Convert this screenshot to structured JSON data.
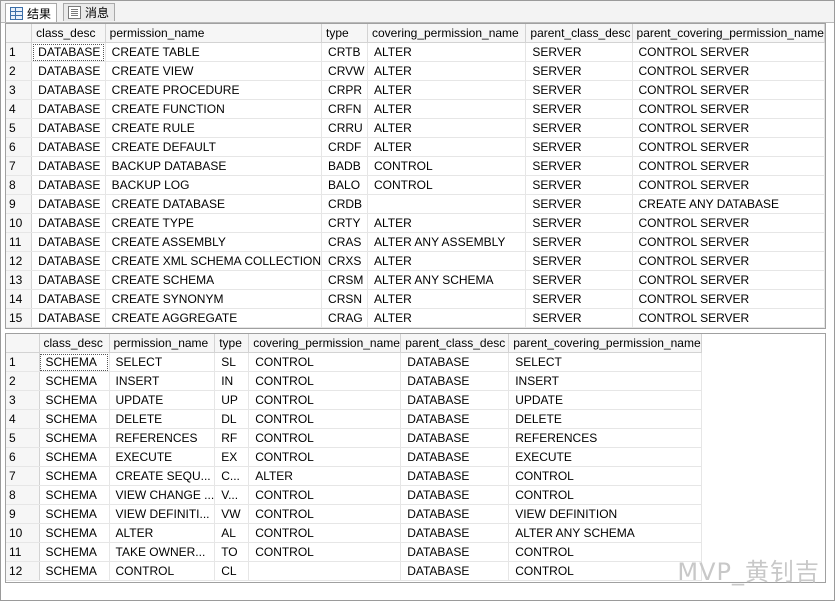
{
  "tabs": [
    {
      "label": "结果",
      "icon": "results-grid-icon"
    },
    {
      "label": "消息",
      "icon": "messages-icon"
    }
  ],
  "grid1": {
    "columns": [
      "class_desc",
      "permission_name",
      "type",
      "covering_permission_name",
      "parent_class_desc",
      "parent_covering_permission_name"
    ],
    "rows": [
      [
        "1",
        "DATABASE",
        "CREATE TABLE",
        "CRTB",
        "ALTER",
        "SERVER",
        "CONTROL SERVER"
      ],
      [
        "2",
        "DATABASE",
        "CREATE VIEW",
        "CRVW",
        "ALTER",
        "SERVER",
        "CONTROL SERVER"
      ],
      [
        "3",
        "DATABASE",
        "CREATE PROCEDURE",
        "CRPR",
        "ALTER",
        "SERVER",
        "CONTROL SERVER"
      ],
      [
        "4",
        "DATABASE",
        "CREATE FUNCTION",
        "CRFN",
        "ALTER",
        "SERVER",
        "CONTROL SERVER"
      ],
      [
        "5",
        "DATABASE",
        "CREATE RULE",
        "CRRU",
        "ALTER",
        "SERVER",
        "CONTROL SERVER"
      ],
      [
        "6",
        "DATABASE",
        "CREATE DEFAULT",
        "CRDF",
        "ALTER",
        "SERVER",
        "CONTROL SERVER"
      ],
      [
        "7",
        "DATABASE",
        "BACKUP DATABASE",
        "BADB",
        "CONTROL",
        "SERVER",
        "CONTROL SERVER"
      ],
      [
        "8",
        "DATABASE",
        "BACKUP LOG",
        "BALO",
        "CONTROL",
        "SERVER",
        "CONTROL SERVER"
      ],
      [
        "9",
        "DATABASE",
        "CREATE DATABASE",
        "CRDB",
        "",
        "SERVER",
        "CREATE ANY DATABASE"
      ],
      [
        "10",
        "DATABASE",
        "CREATE TYPE",
        "CRTY",
        "ALTER",
        "SERVER",
        "CONTROL SERVER"
      ],
      [
        "11",
        "DATABASE",
        "CREATE ASSEMBLY",
        "CRAS",
        "ALTER ANY ASSEMBLY",
        "SERVER",
        "CONTROL SERVER"
      ],
      [
        "12",
        "DATABASE",
        "CREATE XML SCHEMA COLLECTION",
        "CRXS",
        "ALTER",
        "SERVER",
        "CONTROL SERVER"
      ],
      [
        "13",
        "DATABASE",
        "CREATE SCHEMA",
        "CRSM",
        "ALTER ANY SCHEMA",
        "SERVER",
        "CONTROL SERVER"
      ],
      [
        "14",
        "DATABASE",
        "CREATE SYNONYM",
        "CRSN",
        "ALTER",
        "SERVER",
        "CONTROL SERVER"
      ],
      [
        "15",
        "DATABASE",
        "CREATE AGGREGATE",
        "CRAG",
        "ALTER",
        "SERVER",
        "CONTROL SERVER"
      ]
    ]
  },
  "grid2": {
    "columns": [
      "class_desc",
      "permission_name",
      "type",
      "covering_permission_name",
      "parent_class_desc",
      "parent_covering_permission_name"
    ],
    "rows": [
      [
        "1",
        "SCHEMA",
        "SELECT",
        "SL",
        "CONTROL",
        "DATABASE",
        "SELECT"
      ],
      [
        "2",
        "SCHEMA",
        "INSERT",
        "IN",
        "CONTROL",
        "DATABASE",
        "INSERT"
      ],
      [
        "3",
        "SCHEMA",
        "UPDATE",
        "UP",
        "CONTROL",
        "DATABASE",
        "UPDATE"
      ],
      [
        "4",
        "SCHEMA",
        "DELETE",
        "DL",
        "CONTROL",
        "DATABASE",
        "DELETE"
      ],
      [
        "5",
        "SCHEMA",
        "REFERENCES",
        "RF",
        "CONTROL",
        "DATABASE",
        "REFERENCES"
      ],
      [
        "6",
        "SCHEMA",
        "EXECUTE",
        "EX",
        "CONTROL",
        "DATABASE",
        "EXECUTE"
      ],
      [
        "7",
        "SCHEMA",
        "CREATE SEQU...",
        "C...",
        "ALTER",
        "DATABASE",
        "CONTROL"
      ],
      [
        "8",
        "SCHEMA",
        "VIEW CHANGE ...",
        "V...",
        "CONTROL",
        "DATABASE",
        "CONTROL"
      ],
      [
        "9",
        "SCHEMA",
        "VIEW DEFINITI...",
        "VW",
        "CONTROL",
        "DATABASE",
        "VIEW DEFINITION"
      ],
      [
        "10",
        "SCHEMA",
        "ALTER",
        "AL",
        "CONTROL",
        "DATABASE",
        "ALTER ANY SCHEMA"
      ],
      [
        "11",
        "SCHEMA",
        "TAKE OWNER...",
        "TO",
        "CONTROL",
        "DATABASE",
        "CONTROL"
      ],
      [
        "12",
        "SCHEMA",
        "CONTROL",
        "CL",
        "",
        "DATABASE",
        "CONTROL"
      ]
    ]
  },
  "watermark": "MVP_黄钊吉"
}
